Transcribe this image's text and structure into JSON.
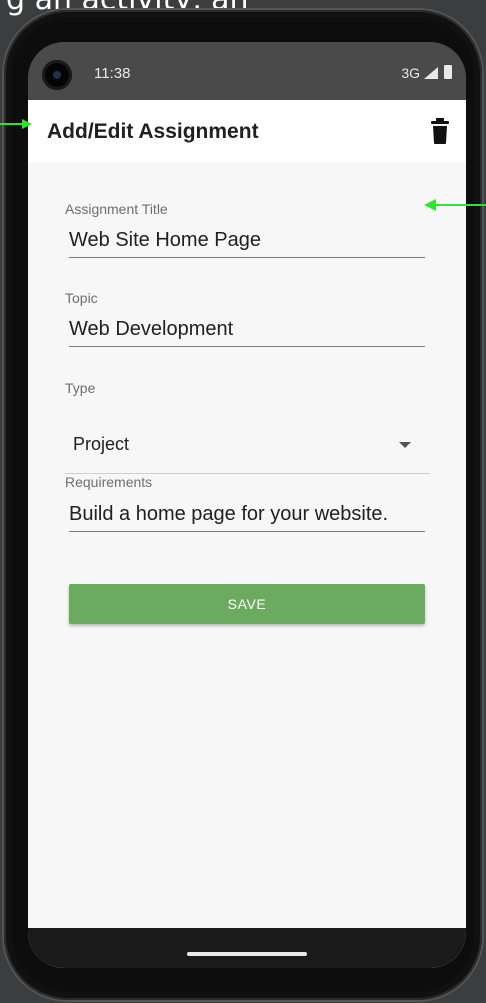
{
  "caption": "g an activity, an",
  "status_bar": {
    "time": "11:38",
    "network": "3G"
  },
  "app_bar": {
    "title": "Add/Edit Assignment",
    "delete_icon": "trash-icon"
  },
  "form": {
    "title_label": "Assignment Title",
    "title_value": "Web Site Home Page",
    "topic_label": "Topic",
    "topic_value": "Web Development",
    "type_label": "Type",
    "type_value": "Project",
    "requirements_label": "Requirements",
    "requirements_value": "Build a home page for your website.",
    "save_label": "SAVE"
  },
  "colors": {
    "save_button": "#6aab5f",
    "annotation_arrow": "#2ee52e",
    "app_bar": "#ffffff",
    "status_bar": "#4a4a4a"
  }
}
